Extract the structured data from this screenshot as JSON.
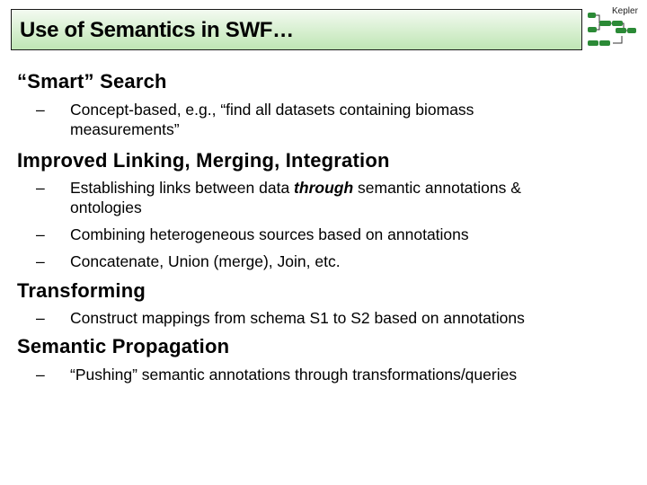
{
  "slide": {
    "title": "Use of Semantics in SWF…",
    "logo": {
      "label": "Kepler",
      "brand_color": "#2e8b3a"
    },
    "dash_glyph": "–",
    "sections": [
      {
        "heading": "“Smart” Search",
        "bullets": [
          {
            "lines": [
              "Concept-based, e.g., “find all datasets containing biomass",
              "measurements”"
            ]
          }
        ]
      },
      {
        "heading": "Improved Linking, Merging, Integration",
        "bullets": [
          {
            "before": "Establishing links between data ",
            "emphasis": "through",
            "after": " semantic annotations &",
            "line2": "ontologies"
          },
          {
            "lines": [
              "Combining heterogeneous sources based on annotations"
            ]
          },
          {
            "lines": [
              "Concatenate, Union (merge), Join, etc."
            ]
          }
        ]
      },
      {
        "heading": "Transforming",
        "bullets": [
          {
            "lines": [
              "Construct mappings from schema S1 to S2 based on annotations"
            ]
          }
        ]
      },
      {
        "heading": "Semantic Propagation",
        "bullets": [
          {
            "lines": [
              "“Pushing” semantic annotations through transformations/queries"
            ]
          }
        ]
      }
    ]
  }
}
